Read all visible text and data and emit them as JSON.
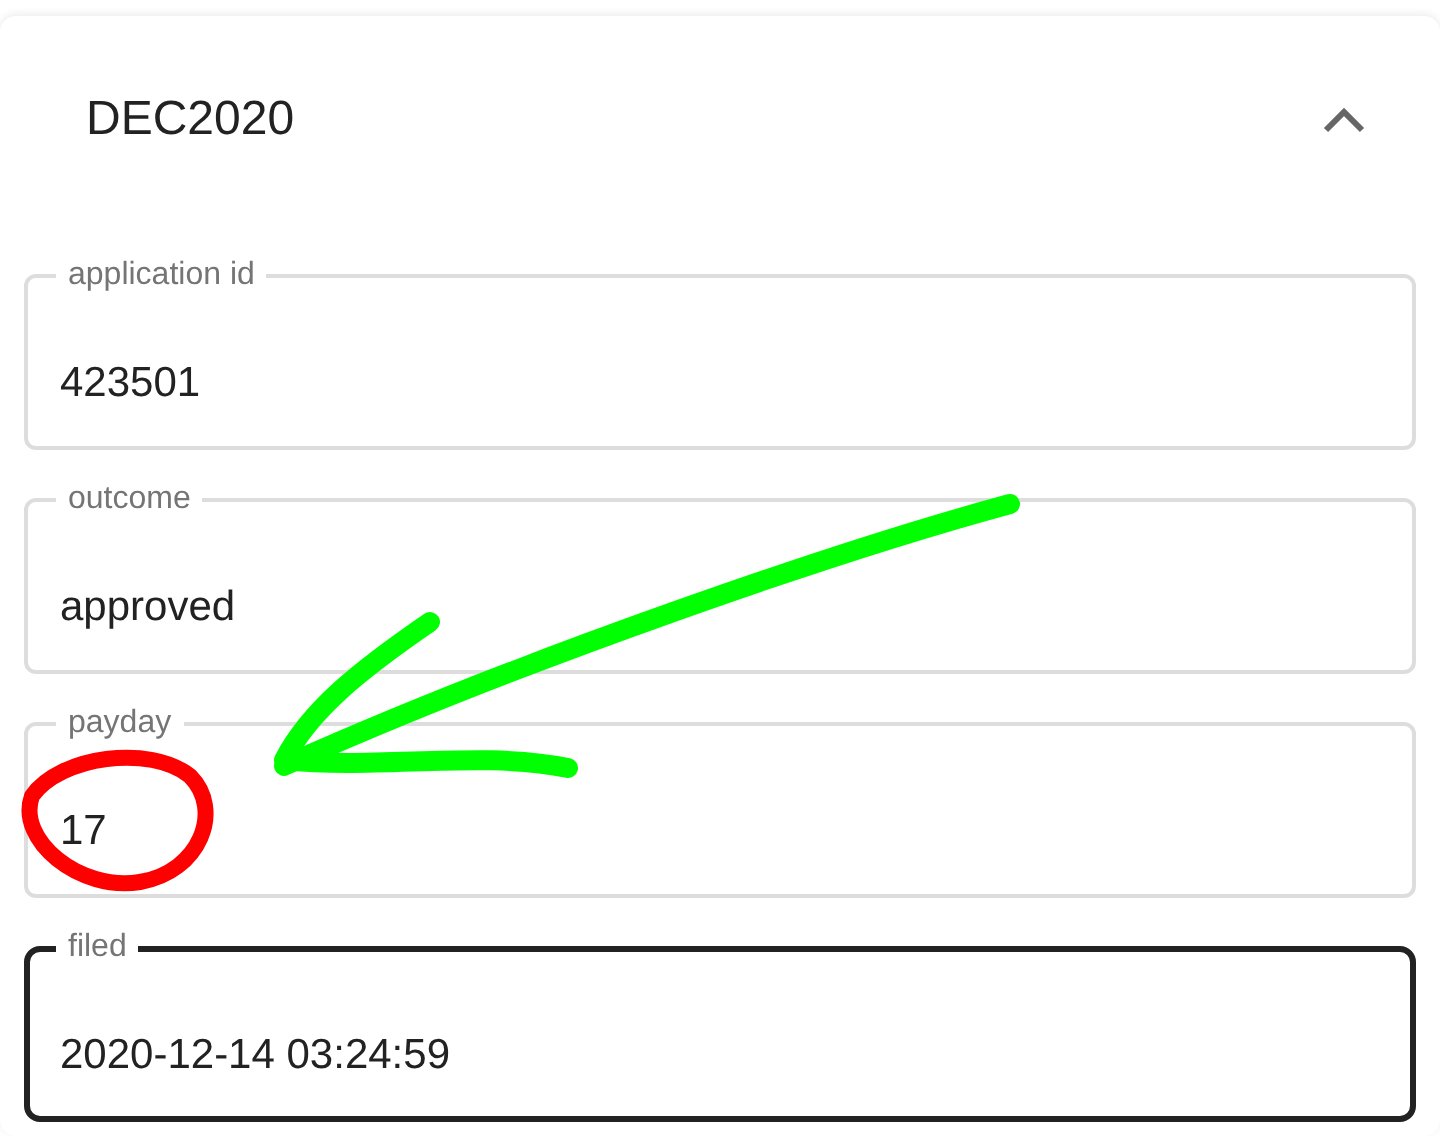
{
  "section": {
    "title": "DEC2020",
    "expanded": true,
    "fields": [
      {
        "label": "application id",
        "value": "423501",
        "focused": false
      },
      {
        "label": "outcome",
        "value": "approved",
        "focused": false
      },
      {
        "label": "payday",
        "value": "17",
        "focused": false
      },
      {
        "label": "filed",
        "value": "2020-12-14 03:24:59",
        "focused": true
      }
    ]
  },
  "annotations": [
    {
      "kind": "arrow",
      "color": "#00ff00"
    },
    {
      "kind": "circle",
      "color": "#ff0000"
    }
  ]
}
